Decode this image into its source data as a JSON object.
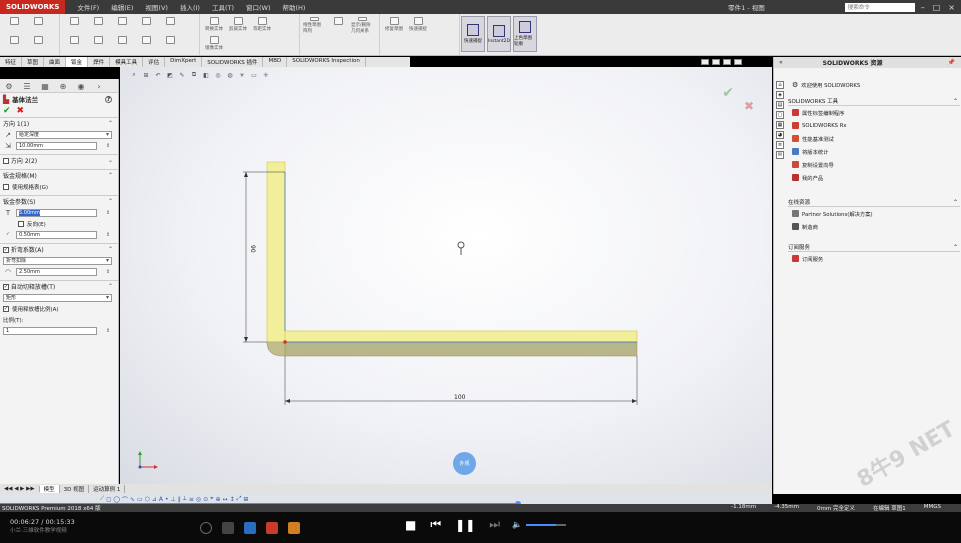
{
  "titlebar": {
    "logo": "SOLIDWORKS",
    "menu": [
      "文件(F)",
      "编辑(E)",
      "视图(V)",
      "插入(I)",
      "工具(T)",
      "窗口(W)",
      "帮助(H)"
    ],
    "document": "零件1 - 视图",
    "search_placeholder": "搜索命令"
  },
  "ribbon": {
    "buttons": [
      "转换实体",
      "剪裁实体",
      "等距实体",
      "镜像实体",
      "线性草图阵列",
      "显示/删除几何关系",
      "修复草图",
      "快速捕捉",
      "快速草图",
      "Instant2D",
      "上色草图轮廓"
    ],
    "big": [
      "快速捕捉",
      "Instant2D",
      "上色草图轮廓"
    ]
  },
  "command_tabs": [
    "特征",
    "草图",
    "曲面",
    "钣金",
    "焊件",
    "模具工具",
    "评估",
    "DimXpert",
    "SOLIDWORKS 插件",
    "MBD",
    "SOLIDWORKS Inspection"
  ],
  "active_command_tab": "钣金",
  "property_manager": {
    "title": "基体法兰",
    "direction1": {
      "label": "方向 1(1)",
      "end_condition": "给定深度",
      "depth": "10.00mm"
    },
    "direction2": {
      "label": "方向 2(2)"
    },
    "gauge": {
      "label": "钣金规格(M)",
      "use_table": "使用规格表(G)"
    },
    "params": {
      "label": "钣金参数(S)",
      "thickness": "5.00mm",
      "reverse": "反向(E)",
      "radius": "0.50mm"
    },
    "bend_allowance": {
      "label": "折弯系数(A)",
      "type": "折弯扣除",
      "value": "2.50mm"
    },
    "relief": {
      "label": "自动切释放槽(T)",
      "type": "矩形",
      "use_ratio": "使用释放槽比例(A)",
      "ratio_label": "比例(T):",
      "ratio": "1"
    }
  },
  "graphics": {
    "dim_vertical": "90",
    "dim_horizontal": "100",
    "appearance_btn": "外观"
  },
  "task_pane": {
    "title": "SOLIDWORKS 资源",
    "welcome": "欢迎使用 SOLIDWORKS",
    "tools_header": "SOLIDWORKS 工具",
    "tools": [
      "属性标签编制程序",
      "SOLIDWORKS Rx",
      "性能基准测试",
      "将版本统计",
      "复制设置向导",
      "我的产品"
    ],
    "community_header": "在线资源",
    "community": [
      "Partner Solutions(解决方案)",
      "制造商"
    ],
    "subscription_header": "订阅服务",
    "subscription": [
      "订阅服务"
    ]
  },
  "bottom_tabs": [
    "模型",
    "3D 视图",
    "运动算例 1"
  ],
  "active_bottom_tab": "模型",
  "statusbar": {
    "left": "SOLIDWORKS Premium 2018 x64 版",
    "x": "-1.18mm",
    "y": "-4.35mm",
    "z": "0mm 完全定义",
    "mode": "在编辑 草图1",
    "units": "MMGS"
  },
  "player": {
    "time": "00:06:27 / 00:15:33",
    "subtitle": "小兰·三维软件教学视频",
    "progress": 0.415,
    "volume": 0.75
  },
  "watermark": "8牛9 NET",
  "colors": {
    "solidworks_red": "#c8281e",
    "model_yellow": "#f2ef9a",
    "accent_blue": "#4a8cff"
  }
}
